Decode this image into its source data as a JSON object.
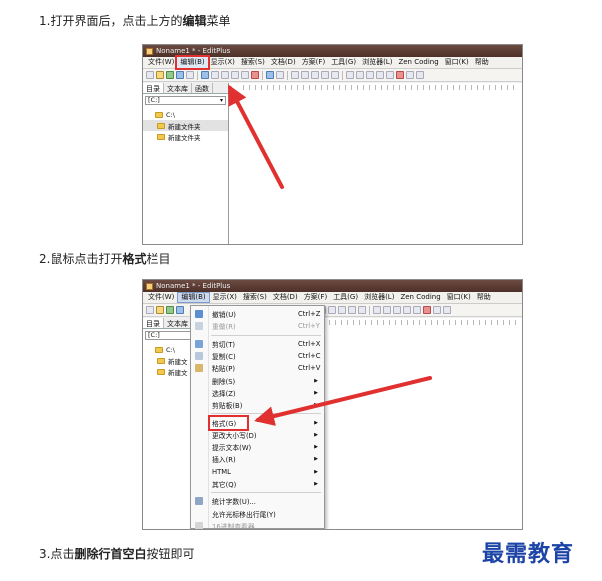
{
  "steps": [
    {
      "prefix": "1.打开界面后，点击上方的",
      "bold": "编辑",
      "suffix": "菜单"
    },
    {
      "prefix": "2.鼠标点击打开",
      "bold": "格式",
      "suffix": "栏目"
    },
    {
      "prefix": "3.点击",
      "bold": "删除行首空白",
      "suffix": "按钮即可"
    }
  ],
  "app_title": "Noname1 * - EditPlus",
  "menubar": [
    "文件(W)",
    "编辑(B)",
    "显示(X)",
    "搜索(S)",
    "文档(D)",
    "方案(F)",
    "工具(G)",
    "浏览器(L)",
    "Zen Coding",
    "窗口(K)",
    "帮助"
  ],
  "left_tabs": [
    "目录",
    "文本库",
    "函数"
  ],
  "drive": "[C:]",
  "tree": [
    "C:\\",
    "新建文件夹",
    "新建文件夹"
  ],
  "tree_short": [
    "C:\\",
    "新建文",
    "新建文"
  ],
  "edit_menu": [
    {
      "label": "撤销(U)",
      "shortcut": "Ctrl+Z",
      "icon": "undo-icon"
    },
    {
      "label": "重做(R)",
      "shortcut": "Ctrl+Y",
      "icon": "redo-icon",
      "disabled": true
    },
    {
      "label": "剪切(T)",
      "shortcut": "Ctrl+X",
      "icon": "cut-icon"
    },
    {
      "label": "复制(C)",
      "shortcut": "Ctrl+C",
      "icon": "copy-icon"
    },
    {
      "label": "粘贴(P)",
      "shortcut": "Ctrl+V",
      "icon": "paste-icon"
    },
    {
      "label": "删除(S)",
      "submenu": true
    },
    {
      "label": "选择(Z)",
      "submenu": true
    },
    {
      "label": "剪贴板(B)",
      "submenu": true
    },
    {
      "label": "格式(G)",
      "submenu": true,
      "highlight": true
    },
    {
      "label": "更改大小写(D)",
      "submenu": true
    },
    {
      "label": "提示文本(W)",
      "submenu": true
    },
    {
      "label": "插入(R)",
      "submenu": true
    },
    {
      "label": "HTML",
      "submenu": true
    },
    {
      "label": "其它(Q)",
      "submenu": true
    },
    {
      "label": "统计字数(U)...",
      "icon": "stats-icon"
    },
    {
      "label": "允许光标移出行尾(Y)"
    },
    {
      "label": "16进制查看器",
      "icon": "hex-icon",
      "disabled": true
    }
  ],
  "watermark": "最需教育",
  "colors": {
    "highlight": "#e03030",
    "watermark": "#1c44a6"
  }
}
